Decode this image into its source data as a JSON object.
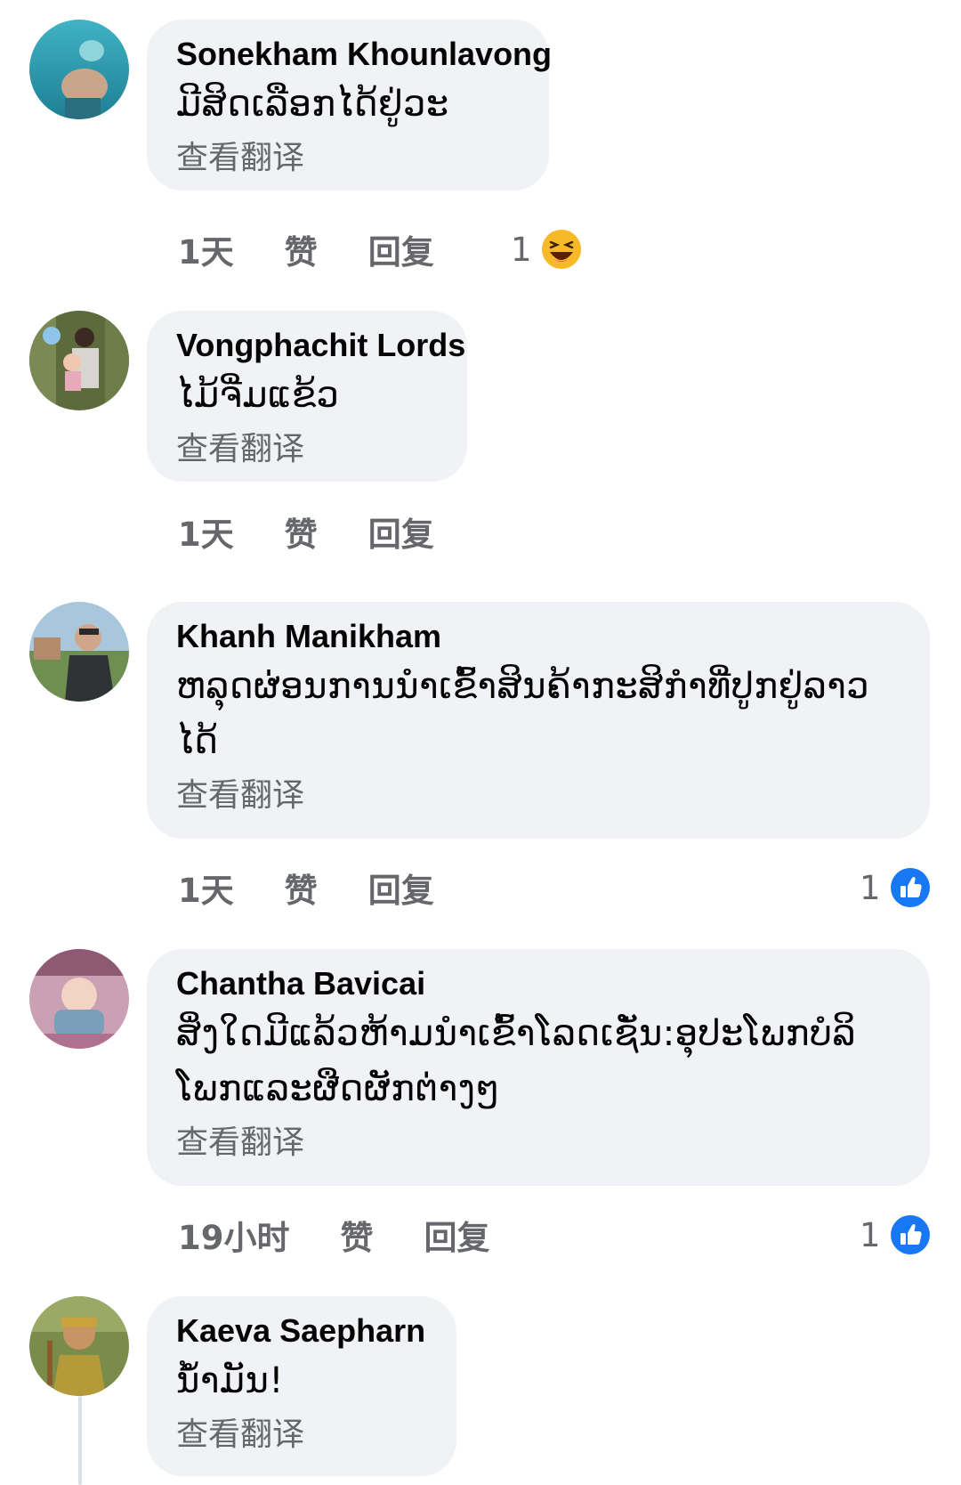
{
  "translate_label": "查看翻译",
  "like_label": "赞",
  "reply_label": "回复",
  "comments": [
    {
      "author": "Sonekham Khounlavong",
      "text": "ມີສິດເລືອກໄດ້ຢູ່ວະ",
      "time": "1天",
      "reaction": {
        "count": "1",
        "icon": "haha-emoji-icon"
      }
    },
    {
      "author": "Vongphachit Lords",
      "text": "ໄມ້ຈີ່ມແຂ້ວ",
      "time": "1天",
      "reaction": null
    },
    {
      "author": "Khanh Manikham",
      "text": "ຫລຸດຜ່ອນການນໍາເຂົ້າສິນຄ້າກະສິກໍາທີ່ປູກຢູ່ລາວໄດ້",
      "time": "1天",
      "reaction": {
        "count": "1",
        "icon": "like-thumb-icon"
      }
    },
    {
      "author": "Chantha Bavicai",
      "text": "ສິ່ງໃດມີແລ້ວຫ້າມນໍາເຂົ້າໂລດເຊັ່ນ:ອຸປະໂພກບໍລິໂພກແລະຜືດຜັກຕ່າງໆ",
      "time": "19小时",
      "reaction": {
        "count": "1",
        "icon": "like-thumb-icon"
      }
    },
    {
      "author": "Kaeva Saepharn",
      "text": "ນໍ້າມັນ!",
      "time": "",
      "reaction": null
    }
  ],
  "colors": {
    "bubble": "#f0f2f5",
    "secondary_text": "#65676b",
    "like_blue": "#1877f2",
    "haha_yellow": "#f7b928"
  }
}
